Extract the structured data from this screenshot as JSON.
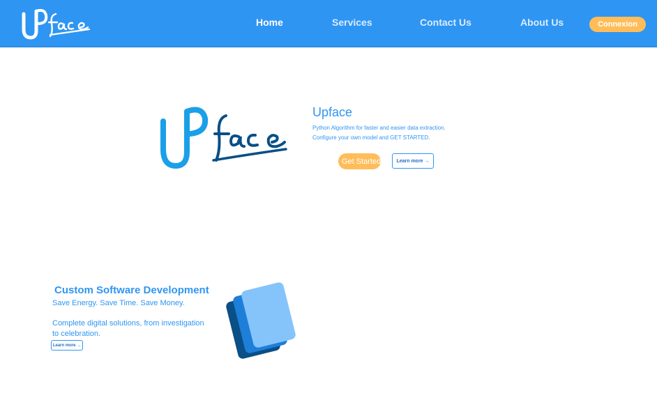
{
  "navbar": {
    "brand": "Upface",
    "links": [
      "Home",
      "Services",
      "Contact Us",
      "About Us"
    ],
    "connexion_label": "Connexion"
  },
  "hero": {
    "logo_alt": "Upface",
    "title": "Upface",
    "line1": "Python Algorithm for faster and easier data extraction.",
    "line2": "Configure your own model and GET STARTED.",
    "get_started_label": "Get Started",
    "learn_more_label": "Learn more →"
  },
  "feature": {
    "title": "Custom Software Development",
    "tagline": "Save Energy. Save Time. Save Money.",
    "desc_line1": "Complete digital solutions, from investigation",
    "desc_line2": "to celebration.",
    "learn_more_label": "Learn more →"
  },
  "colors": {
    "primary": "#2f95f2",
    "accent": "#ffbd5a",
    "dark_blue": "#0a4f86"
  }
}
